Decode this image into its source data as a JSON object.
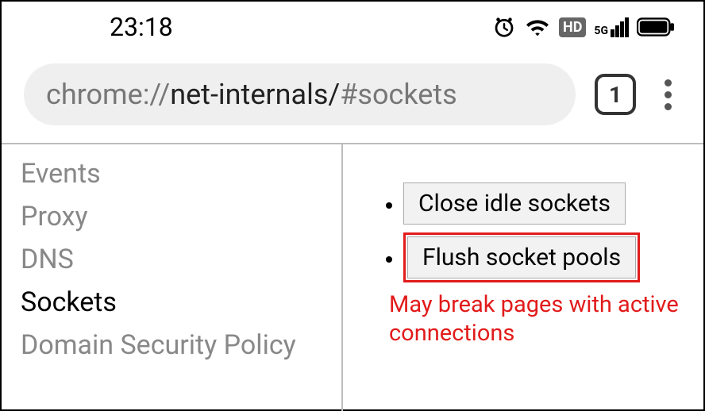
{
  "status": {
    "time": "23:18",
    "alarm_icon": "alarm-icon",
    "wifi_icon": "wifi-icon",
    "hd_badge": "HD",
    "signal_label": "5G",
    "battery_icon": "battery-icon"
  },
  "browser": {
    "url_prefix": "chrome://",
    "url_main": "net-internals/",
    "url_fragment": "#sockets",
    "tab_count": "1"
  },
  "sidebar": {
    "items": [
      {
        "label": "Events",
        "active": false
      },
      {
        "label": "Proxy",
        "active": false
      },
      {
        "label": "DNS",
        "active": false
      },
      {
        "label": "Sockets",
        "active": true
      },
      {
        "label": "Domain Security Policy",
        "active": false
      }
    ]
  },
  "main": {
    "buttons": {
      "close_idle": "Close idle sockets",
      "flush_pools": "Flush socket pools"
    },
    "warning": "May break pages with active connections"
  }
}
